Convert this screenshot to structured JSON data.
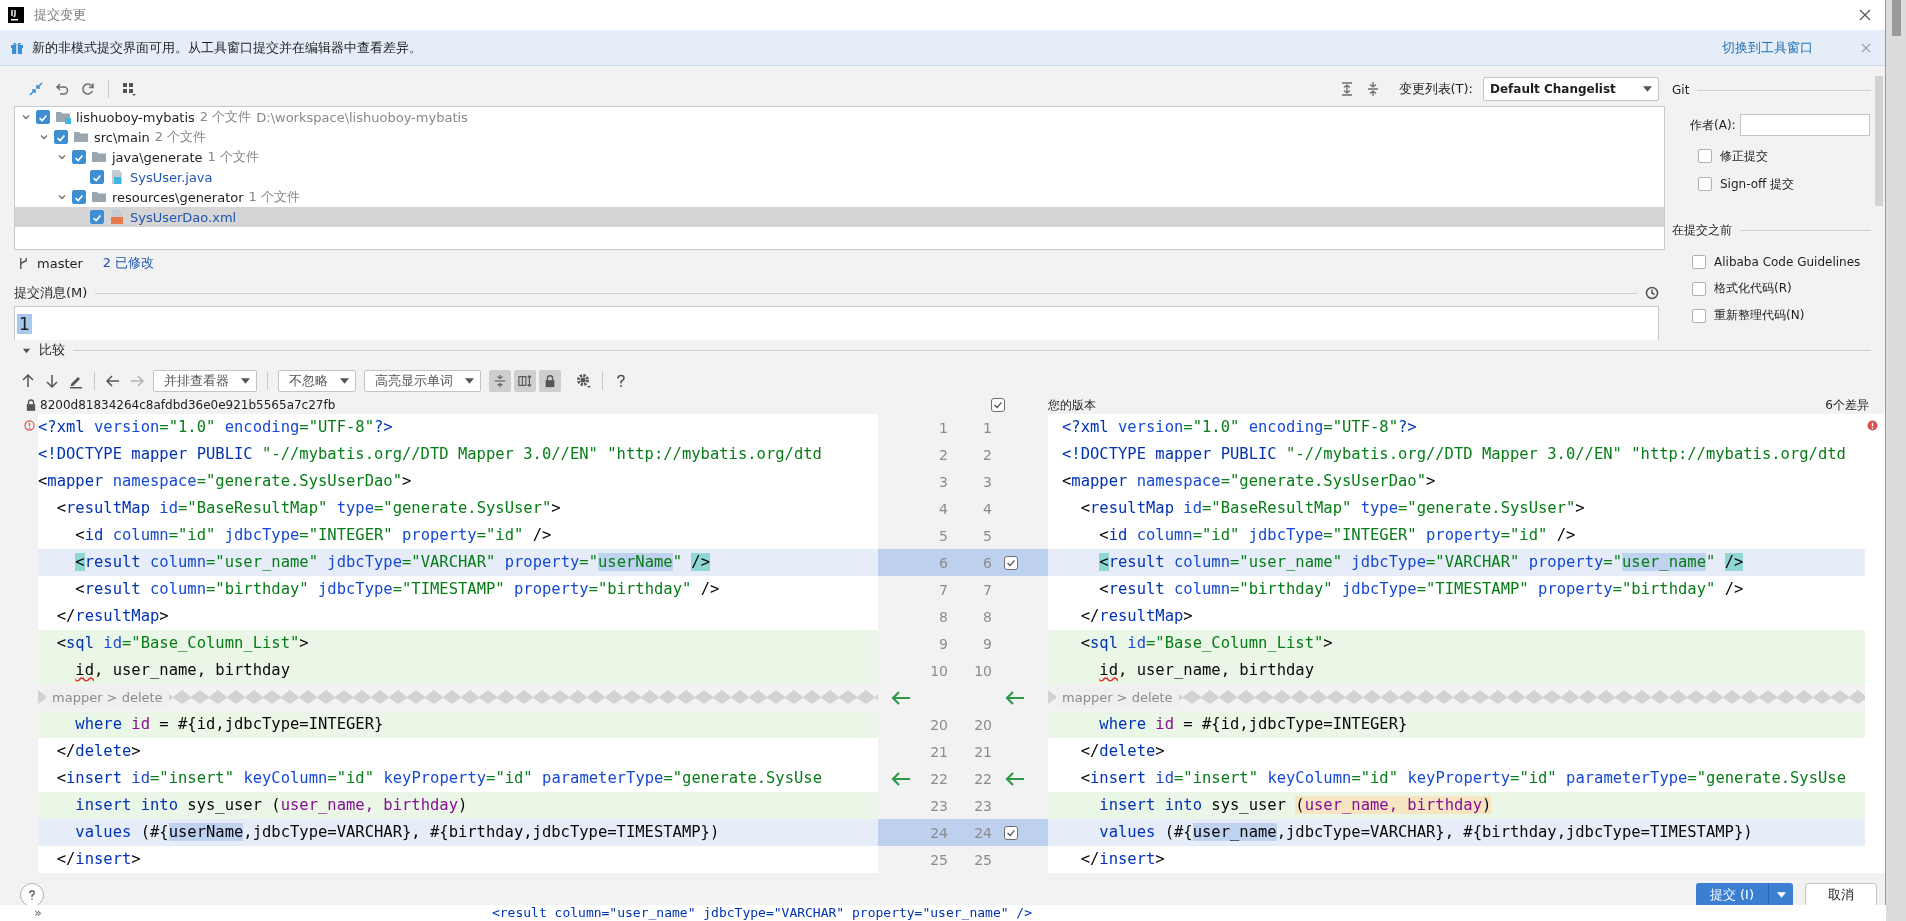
{
  "window": {
    "title": "提交变更"
  },
  "banner": {
    "text": "新的非模式提交界面可用。从工具窗口提交并在编辑器中查看差异。",
    "link": "切换到工具窗口"
  },
  "changelist": {
    "label": "变更列表(T):",
    "value": "Default Changelist"
  },
  "tree": [
    {
      "kind": "module",
      "label": "lishuoboy-mybatis",
      "count": "2 个文件",
      "path": "D:\\workspace\\lishuoboy-mybatis",
      "checked": true,
      "expanded": true,
      "selected": false,
      "children": [
        {
          "kind": "folder",
          "label": "src\\main",
          "count": "2 个文件",
          "checked": true,
          "expanded": true,
          "selected": false,
          "children": [
            {
              "kind": "folder",
              "label": "java\\generate",
              "count": "1 个文件",
              "checked": true,
              "expanded": true,
              "selected": false,
              "children": [
                {
                  "kind": "java",
                  "label": "SysUser.java",
                  "checked": true,
                  "selected": false
                }
              ]
            },
            {
              "kind": "folder",
              "label": "resources\\generator",
              "count": "1 个文件",
              "checked": true,
              "expanded": true,
              "selected": false,
              "children": [
                {
                  "kind": "xml",
                  "label": "SysUserDao.xml",
                  "checked": true,
                  "selected": true
                }
              ]
            }
          ]
        }
      ]
    }
  ],
  "branch": {
    "name": "master",
    "changes": "2 已修改"
  },
  "commit_message": {
    "label": "提交消息(M)",
    "value": "1"
  },
  "git_panel": {
    "title": "Git",
    "author_label": "作者(A):",
    "options": [
      {
        "label": "修正提交",
        "checked": false
      },
      {
        "label": "Sign-off 提交",
        "checked": false
      }
    ],
    "before_title": "在提交之前",
    "before_options": [
      {
        "label": "Alibaba Code Guidelines",
        "checked": false
      },
      {
        "label": "格式化代码(R)",
        "checked": false
      },
      {
        "label": "重新整理代码(N)",
        "checked": false
      }
    ]
  },
  "compare": {
    "title": "比较",
    "expanded": true
  },
  "diff_toolbar": {
    "arrows": [
      {
        "kind": "left",
        "disabled": false
      },
      {
        "kind": "right",
        "disabled": true
      }
    ],
    "dropdowns": [
      "并排查看器",
      "不忽略",
      "高亮显示单词"
    ],
    "toggles": [
      {
        "on": true
      },
      {
        "on": true
      },
      {
        "on": true
      }
    ]
  },
  "diff_header": {
    "left_revision": "8200d81834264c8afdbd36e0e921b5565a7c27fb",
    "apply_all_checked": true,
    "right_title": "您的版本",
    "diff_count": "6个差异"
  },
  "diff_rows": [
    {
      "kind": "same",
      "left_number": "1",
      "right_number": "1",
      "left": [
        {
          "kind": "tag",
          "text": "<?xml"
        },
        {
          "kind": "attr",
          "text": " version"
        },
        {
          "kind": "string",
          "text": "=\"1.0\""
        },
        {
          "kind": "attr",
          "text": " encoding"
        },
        {
          "kind": "string",
          "text": "=\"UTF-8\""
        },
        {
          "kind": "tag",
          "text": "?>"
        }
      ],
      "right": [
        {
          "kind": "tag",
          "text": "<?xml"
        },
        {
          "kind": "attr",
          "text": " version"
        },
        {
          "kind": "string",
          "text": "=\"1.0\""
        },
        {
          "kind": "attr",
          "text": " encoding"
        },
        {
          "kind": "string",
          "text": "=\"UTF-8\""
        },
        {
          "kind": "tag",
          "text": "?>"
        }
      ]
    },
    {
      "kind": "same",
      "left_number": "2",
      "right_number": "2",
      "left": [
        {
          "kind": "tag",
          "text": "<!DOCTYPE mapper PUBLIC"
        },
        {
          "kind": "string",
          "text": " \"-//mybatis.org//DTD Mapper 3.0//EN\" \"http://mybatis.org/dtd"
        }
      ],
      "right": [
        {
          "kind": "tag",
          "text": "<!DOCTYPE mapper PUBLIC"
        },
        {
          "kind": "string",
          "text": " \"-//mybatis.org//DTD Mapper 3.0//EN\" \"http://mybatis.org/dtd"
        }
      ]
    },
    {
      "kind": "same",
      "left_number": "3",
      "right_number": "3",
      "left": [
        {
          "kind": "plain",
          "text": "<"
        },
        {
          "kind": "tag",
          "text": "mapper"
        },
        {
          "kind": "attr",
          "text": " namespace"
        },
        {
          "kind": "string",
          "text": "=\"generate.SysUserDao\""
        },
        {
          "kind": "plain",
          "text": ">"
        }
      ],
      "right": [
        {
          "kind": "plain",
          "text": "<"
        },
        {
          "kind": "tag",
          "text": "mapper"
        },
        {
          "kind": "attr",
          "text": " namespace"
        },
        {
          "kind": "string",
          "text": "=\"generate.SysUserDao\""
        },
        {
          "kind": "plain",
          "text": ">"
        }
      ]
    },
    {
      "kind": "same",
      "left_number": "4",
      "right_number": "4",
      "left": [
        {
          "kind": "plain",
          "text": "  <"
        },
        {
          "kind": "tag",
          "text": "resultMap"
        },
        {
          "kind": "attr",
          "text": " id"
        },
        {
          "kind": "string",
          "text": "=\"BaseResultMap\""
        },
        {
          "kind": "attr",
          "text": " type"
        },
        {
          "kind": "string",
          "text": "=\"generate.SysUser\""
        },
        {
          "kind": "plain",
          "text": ">"
        }
      ],
      "right": [
        {
          "kind": "plain",
          "text": "  <"
        },
        {
          "kind": "tag",
          "text": "resultMap"
        },
        {
          "kind": "attr",
          "text": " id"
        },
        {
          "kind": "string",
          "text": "=\"BaseResultMap\""
        },
        {
          "kind": "attr",
          "text": " type"
        },
        {
          "kind": "string",
          "text": "=\"generate.SysUser\""
        },
        {
          "kind": "plain",
          "text": ">"
        }
      ]
    },
    {
      "kind": "same",
      "left_number": "5",
      "right_number": "5",
      "left": [
        {
          "kind": "plain",
          "text": "    <"
        },
        {
          "kind": "tag",
          "text": "id"
        },
        {
          "kind": "attr",
          "text": " column"
        },
        {
          "kind": "string",
          "text": "=\"id\""
        },
        {
          "kind": "attr",
          "text": " jdbcType"
        },
        {
          "kind": "string",
          "text": "=\"INTEGER\""
        },
        {
          "kind": "attr",
          "text": " property"
        },
        {
          "kind": "string",
          "text": "=\"id\""
        },
        {
          "kind": "plain",
          "text": " />"
        }
      ],
      "right": [
        {
          "kind": "plain",
          "text": "    <"
        },
        {
          "kind": "tag",
          "text": "id"
        },
        {
          "kind": "attr",
          "text": " column"
        },
        {
          "kind": "string",
          "text": "=\"id\""
        },
        {
          "kind": "attr",
          "text": " jdbcType"
        },
        {
          "kind": "string",
          "text": "=\"INTEGER\""
        },
        {
          "kind": "attr",
          "text": " property"
        },
        {
          "kind": "string",
          "text": "=\"id\""
        },
        {
          "kind": "plain",
          "text": " />"
        }
      ]
    },
    {
      "kind": "changed",
      "left_number": "6",
      "right_number": "6",
      "checked": true,
      "left": [
        {
          "kind": "plain",
          "text": "    <",
          "color": "#8fd6d4"
        },
        {
          "kind": "tag",
          "text": "result"
        },
        {
          "kind": "attr",
          "text": " column"
        },
        {
          "kind": "string",
          "text": "=\"user_name\""
        },
        {
          "kind": "attr",
          "text": " jdbcType"
        },
        {
          "kind": "string",
          "text": "=\"VARCHAR\""
        },
        {
          "kind": "attr",
          "text": " property"
        },
        {
          "kind": "string",
          "text": "=\""
        },
        {
          "kind": "string",
          "text": "userName",
          "color": "#bfd2ef"
        },
        {
          "kind": "string",
          "text": "\""
        },
        {
          "kind": "plain",
          "text": " />",
          "color": "#8fd6d4"
        }
      ],
      "right": [
        {
          "kind": "plain",
          "text": "    <",
          "color": "#8fd6d4"
        },
        {
          "kind": "tag",
          "text": "result"
        },
        {
          "kind": "attr",
          "text": " column"
        },
        {
          "kind": "string",
          "text": "=\"user_name\""
        },
        {
          "kind": "attr",
          "text": " jdbcType"
        },
        {
          "kind": "string",
          "text": "=\"VARCHAR\""
        },
        {
          "kind": "attr",
          "text": " property"
        },
        {
          "kind": "string",
          "text": "=\""
        },
        {
          "kind": "string",
          "text": "user_name",
          "color": "#bfd2ef"
        },
        {
          "kind": "string",
          "text": "\""
        },
        {
          "kind": "plain",
          "text": " />",
          "color": "#8fd6d4"
        }
      ]
    },
    {
      "kind": "same",
      "left_number": "7",
      "right_number": "7",
      "left": [
        {
          "kind": "plain",
          "text": "    <"
        },
        {
          "kind": "tag",
          "text": "result"
        },
        {
          "kind": "attr",
          "text": " column"
        },
        {
          "kind": "string",
          "text": "=\"birthday\""
        },
        {
          "kind": "attr",
          "text": " jdbcType"
        },
        {
          "kind": "string",
          "text": "=\"TIMESTAMP\""
        },
        {
          "kind": "attr",
          "text": " property"
        },
        {
          "kind": "string",
          "text": "=\"birthday\""
        },
        {
          "kind": "plain",
          "text": " />"
        }
      ],
      "right": [
        {
          "kind": "plain",
          "text": "    <"
        },
        {
          "kind": "tag",
          "text": "result"
        },
        {
          "kind": "attr",
          "text": " column"
        },
        {
          "kind": "string",
          "text": "=\"birthday\""
        },
        {
          "kind": "attr",
          "text": " jdbcType"
        },
        {
          "kind": "string",
          "text": "=\"TIMESTAMP\""
        },
        {
          "kind": "attr",
          "text": " property"
        },
        {
          "kind": "string",
          "text": "=\"birthday\""
        },
        {
          "kind": "plain",
          "text": " />"
        }
      ]
    },
    {
      "kind": "same",
      "left_number": "8",
      "right_number": "8",
      "left": [
        {
          "kind": "plain",
          "text": "  </"
        },
        {
          "kind": "tag",
          "text": "resultMap"
        },
        {
          "kind": "plain",
          "text": ">"
        }
      ],
      "right": [
        {
          "kind": "plain",
          "text": "  </"
        },
        {
          "kind": "tag",
          "text": "resultMap"
        },
        {
          "kind": "plain",
          "text": ">"
        }
      ]
    },
    {
      "kind": "added",
      "left_number": "9",
      "right_number": "9",
      "left": [
        {
          "kind": "plain",
          "text": "  <"
        },
        {
          "kind": "tag",
          "text": "sql"
        },
        {
          "kind": "attr",
          "text": " id"
        },
        {
          "kind": "string",
          "text": "=\"Base_Column_List\""
        },
        {
          "kind": "plain",
          "text": ">"
        }
      ],
      "right": [
        {
          "kind": "plain",
          "text": "  <"
        },
        {
          "kind": "tag",
          "text": "sql"
        },
        {
          "kind": "attr",
          "text": " id"
        },
        {
          "kind": "string",
          "text": "=\"Base_Column_List\""
        },
        {
          "kind": "plain",
          "text": ">"
        }
      ]
    },
    {
      "kind": "added",
      "left_number": "10",
      "right_number": "10",
      "left": [
        {
          "kind": "plain",
          "text": "    id",
          "typo": true
        },
        {
          "kind": "plain",
          "text": ", user_name, birthday"
        }
      ],
      "right": [
        {
          "kind": "plain",
          "text": "    id",
          "typo": true
        },
        {
          "kind": "plain",
          "text": ", user_name, birthday"
        }
      ]
    },
    {
      "kind": "fold",
      "left_label": "mapper > delete",
      "right_label": "mapper > delete",
      "arrow": true
    },
    {
      "kind": "added",
      "left_number": "20",
      "right_number": "20",
      "left": [
        {
          "kind": "keyword",
          "text": "    where"
        },
        {
          "kind": "column",
          "text": " id"
        },
        {
          "kind": "plain",
          "text": " = #{id,jdbcType=INTEGER}"
        }
      ],
      "right": [
        {
          "kind": "keyword",
          "text": "    where"
        },
        {
          "kind": "column",
          "text": " id"
        },
        {
          "kind": "plain",
          "text": " = #{id,jdbcType=INTEGER}"
        }
      ]
    },
    {
      "kind": "same",
      "left_number": "21",
      "right_number": "21",
      "left": [
        {
          "kind": "plain",
          "text": "  </"
        },
        {
          "kind": "tag",
          "text": "delete"
        },
        {
          "kind": "plain",
          "text": ">"
        }
      ],
      "right": [
        {
          "kind": "plain",
          "text": "  </"
        },
        {
          "kind": "tag",
          "text": "delete"
        },
        {
          "kind": "plain",
          "text": ">"
        }
      ]
    },
    {
      "kind": "same",
      "left_number": "22",
      "right_number": "22",
      "arrow": true,
      "left": [
        {
          "kind": "plain",
          "text": "  <"
        },
        {
          "kind": "tag",
          "text": "insert"
        },
        {
          "kind": "attr",
          "text": " id"
        },
        {
          "kind": "string",
          "text": "=\"insert\""
        },
        {
          "kind": "attr",
          "text": " keyColumn"
        },
        {
          "kind": "string",
          "text": "=\"id\""
        },
        {
          "kind": "attr",
          "text": " keyProperty"
        },
        {
          "kind": "string",
          "text": "=\"id\""
        },
        {
          "kind": "attr",
          "text": " parameterType"
        },
        {
          "kind": "string",
          "text": "=\"generate.SysUse"
        }
      ],
      "right": [
        {
          "kind": "plain",
          "text": "  <"
        },
        {
          "kind": "tag",
          "text": "insert"
        },
        {
          "kind": "attr",
          "text": " id"
        },
        {
          "kind": "string",
          "text": "=\"insert\""
        },
        {
          "kind": "attr",
          "text": " keyColumn"
        },
        {
          "kind": "string",
          "text": "=\"id\""
        },
        {
          "kind": "attr",
          "text": " keyProperty"
        },
        {
          "kind": "string",
          "text": "=\"id\""
        },
        {
          "kind": "attr",
          "text": " parameterType"
        },
        {
          "kind": "string",
          "text": "=\"generate.SysUse"
        }
      ]
    },
    {
      "kind": "added",
      "left_number": "23",
      "right_number": "23",
      "left": [
        {
          "kind": "keyword",
          "text": "    insert into"
        },
        {
          "kind": "plain",
          "text": " sys_user ("
        },
        {
          "kind": "column",
          "text": "user_name, birthday"
        },
        {
          "kind": "plain",
          "text": ")"
        }
      ],
      "right": [
        {
          "kind": "keyword",
          "text": "    insert into"
        },
        {
          "kind": "plain",
          "text": " sys_user"
        },
        {
          "kind": "plain",
          "text": " (",
          "color": "#f6e5c0"
        },
        {
          "kind": "column",
          "text": "user_name, birthday",
          "color": "#f6e5c0"
        },
        {
          "kind": "plain",
          "text": ")",
          "color": "#f6e5c0"
        }
      ]
    },
    {
      "kind": "changed",
      "left_number": "24",
      "right_number": "24",
      "checked": true,
      "left": [
        {
          "kind": "keyword",
          "text": "    values"
        },
        {
          "kind": "plain",
          "text": " (#{"
        },
        {
          "kind": "plain",
          "text": "userName",
          "color": "#bfd2ef"
        },
        {
          "kind": "plain",
          "text": ",jdbcType=VARCHAR}, #{birthday,jdbcType=TIMESTAMP})"
        }
      ],
      "right": [
        {
          "kind": "keyword",
          "text": "    values"
        },
        {
          "kind": "plain",
          "text": " (#{"
        },
        {
          "kind": "plain",
          "text": "user_name",
          "color": "#bfd2ef"
        },
        {
          "kind": "plain",
          "text": ",jdbcType=VARCHAR}, #{birthday,jdbcType=TIMESTAMP})"
        }
      ]
    },
    {
      "kind": "same",
      "left_number": "25",
      "right_number": "25",
      "left": [
        {
          "kind": "plain",
          "text": "  </"
        },
        {
          "kind": "tag",
          "text": "insert"
        },
        {
          "kind": "plain",
          "text": ">"
        }
      ],
      "right": [
        {
          "kind": "plain",
          "text": "  </"
        },
        {
          "kind": "tag",
          "text": "insert"
        },
        {
          "kind": "plain",
          "text": ">"
        }
      ]
    }
  ],
  "buttons": {
    "commit": "提交 (I)",
    "cancel": "取消"
  },
  "background_editor": {
    "marker": "»",
    "code": "<result column=\"user_name\" jdbcType=\"VARCHAR\" property=\"user_name\" />"
  }
}
